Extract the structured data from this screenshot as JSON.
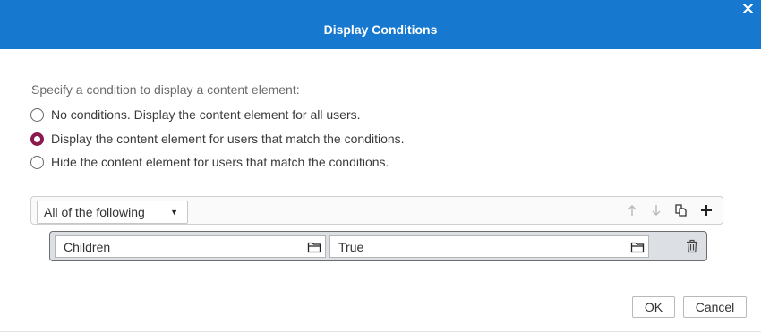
{
  "dialog": {
    "title": "Display Conditions",
    "close_icon": "close-icon",
    "accent_color": "#1679cf"
  },
  "prompt": "Specify a condition to display a content element:",
  "options": [
    {
      "label": "No conditions. Display the content element for all users.",
      "checked": false
    },
    {
      "label": "Display the content element for users that match the conditions.",
      "checked": true
    },
    {
      "label": "Hide the content element for users that match the conditions.",
      "checked": false
    }
  ],
  "condition_group": {
    "match_mode": "All of the following",
    "toolbar_icons": [
      "arrow-up-icon",
      "arrow-down-icon",
      "copy-icon",
      "plus-icon"
    ]
  },
  "rules": [
    {
      "left_value": "Children",
      "right_value": "True"
    }
  ],
  "buttons": {
    "ok": "OK",
    "cancel": "Cancel"
  }
}
